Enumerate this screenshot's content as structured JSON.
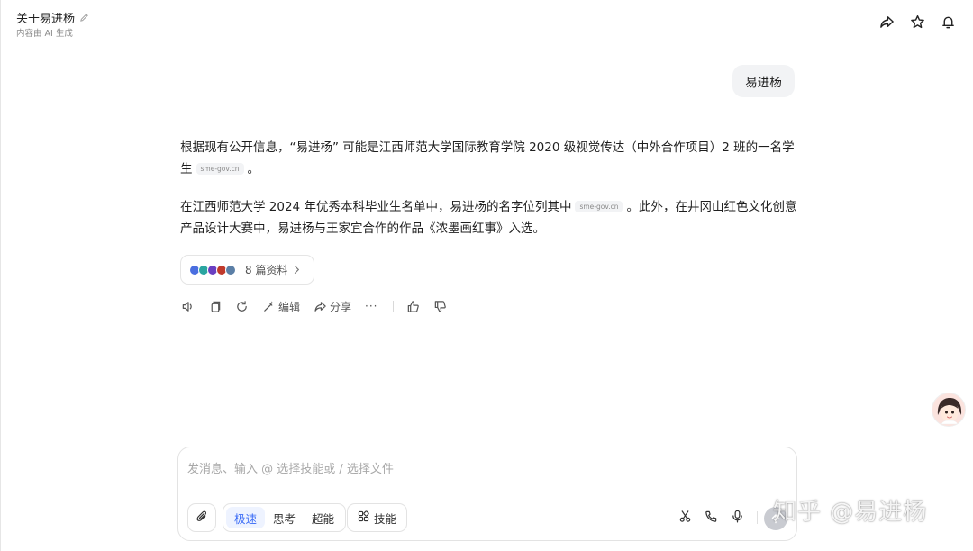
{
  "header": {
    "title": "关于易进杨",
    "subtitle": "内容由 AI 生成"
  },
  "user_message": "易进杨",
  "answer": {
    "p1_text": "根据现有公开信息，“易进杨” 可能是江西师范大学国际教育学院 2020 级视觉传达（中外合作项目）2 班的一名学生",
    "p1_cite": "sme-gov.cn",
    "p1_end": "。",
    "p2_text": "在江西师范大学 2024 年优秀本科毕业生名单中，易进杨的名字位列其中",
    "p2_cite": "sme-gov.cn",
    "p2_end": "。此外，在井冈山红色文化创意产品设计大赛中，易进杨与王家宜合作的作品《浓墨画红事》入选。"
  },
  "sources": {
    "label": "8 篇资料",
    "icon_colors": [
      "#4a6ee0",
      "#2aa5a0",
      "#6a3fc1",
      "#c0392b",
      "#5b7fa6"
    ]
  },
  "actions": {
    "edit_label": "编辑",
    "share_label": "分享",
    "more_label": "···"
  },
  "input": {
    "placeholder": "发消息、输入 @ 选择技能或 / 选择文件",
    "modes": [
      "极速",
      "思考",
      "超能"
    ],
    "active_mode": "极速",
    "skill_label": "技能"
  },
  "watermark": "知乎 @易进杨",
  "colors": {
    "accent": "#3b6cf6",
    "accent_bg": "#eef3ff"
  }
}
